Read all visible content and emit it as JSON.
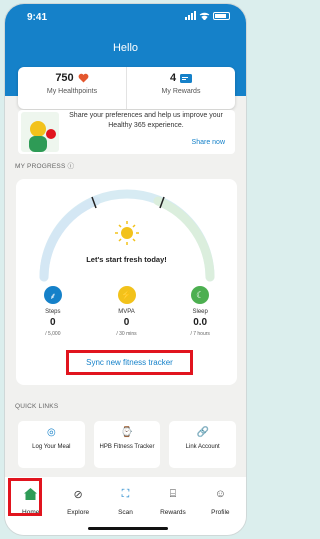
{
  "status": {
    "time": "9:41"
  },
  "header": {
    "title": "Hello"
  },
  "stats": {
    "healthpoints_value": "750",
    "healthpoints_label": "My Healthpoints",
    "rewards_value": "4",
    "rewards_label": "My Rewards"
  },
  "promo": {
    "text": "Share your preferences and help us improve your Healthy 365 experience.",
    "link": "Share now"
  },
  "progress": {
    "section_title": "MY PROGRESS",
    "message": "Let's start fresh today!",
    "metrics": [
      {
        "name": "Steps",
        "value": "0",
        "goal": "/ 5,000",
        "color": "#1581c9",
        "icon": "footsteps-icon"
      },
      {
        "name": "MVPA",
        "value": "0",
        "goal": "/ 30 mins",
        "color": "#f2c21b",
        "icon": "lightning-icon"
      },
      {
        "name": "Sleep",
        "value": "0.0",
        "goal": "/ 7 hours",
        "color": "#4caf50",
        "icon": "moon-icon"
      }
    ],
    "sync_label": "Sync new fitness tracker"
  },
  "quick_links": {
    "section_title": "QUICK LINKS",
    "items": [
      {
        "label": "Log Your Meal"
      },
      {
        "label": "HPB Fitness Tracker"
      },
      {
        "label": "Link Account"
      }
    ]
  },
  "nav": {
    "items": [
      {
        "label": "Home"
      },
      {
        "label": "Explore"
      },
      {
        "label": "Scan"
      },
      {
        "label": "Rewards"
      },
      {
        "label": "Profile"
      }
    ]
  },
  "colors": {
    "brand": "#1581c9",
    "highlight": "#e1141e",
    "heart": "#e4572e"
  }
}
